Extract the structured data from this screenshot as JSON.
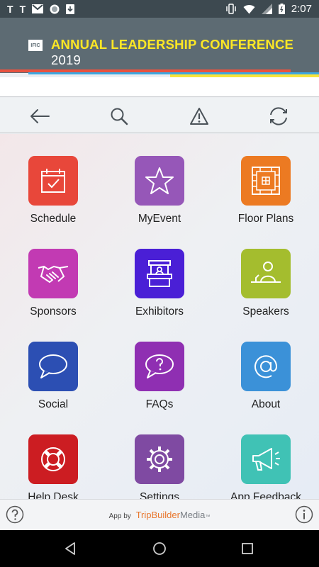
{
  "status_bar": {
    "left_icons": [
      "T",
      "T"
    ],
    "other_icons": [
      "gmail-icon",
      "circle-dots-icon",
      "download-icon"
    ],
    "time": "2:07"
  },
  "header": {
    "logo_text": "IFIC",
    "title": "ANNUAL LEADERSHIP CONFERENCE",
    "year": "2019",
    "accent_colors": {
      "yellow": "#fde725",
      "red": "#e9523f",
      "blue": "#3ea7df"
    }
  },
  "toolbar": {
    "icons": [
      "back-arrow-icon",
      "search-icon",
      "alert-icon",
      "refresh-icon"
    ]
  },
  "tiles": [
    {
      "label": "Schedule",
      "color": "#e8473a",
      "icon": "calendar-check-icon"
    },
    {
      "label": "MyEvent",
      "color": "#9657b8",
      "icon": "star-icon"
    },
    {
      "label": "Floor Plans",
      "color": "#ec7a22",
      "icon": "floor-plan-icon"
    },
    {
      "label": "Sponsors",
      "color": "#c23ab3",
      "icon": "handshake-icon"
    },
    {
      "label": "Exhibitors",
      "color": "#4a1fd6",
      "icon": "booth-icon"
    },
    {
      "label": "Speakers",
      "color": "#a4bd2e",
      "icon": "speaker-podium-icon"
    },
    {
      "label": "Social",
      "color": "#2c4fb3",
      "icon": "chat-bubble-icon"
    },
    {
      "label": "FAQs",
      "color": "#8f2fb2",
      "icon": "question-bubble-icon"
    },
    {
      "label": "About",
      "color": "#3b91d8",
      "icon": "at-sign-icon"
    },
    {
      "label": "Help Desk",
      "color": "#cc1d22",
      "icon": "lifebuoy-icon"
    },
    {
      "label": "Settings",
      "color": "#7f4aa2",
      "icon": "gear-icon"
    },
    {
      "label": "App Feedback",
      "color": "#40c2b5",
      "icon": "megaphone-icon"
    }
  ],
  "footer": {
    "app_by": "App by",
    "brand": "TripBuilder",
    "brand_suffix": "Media",
    "tm": "™"
  }
}
